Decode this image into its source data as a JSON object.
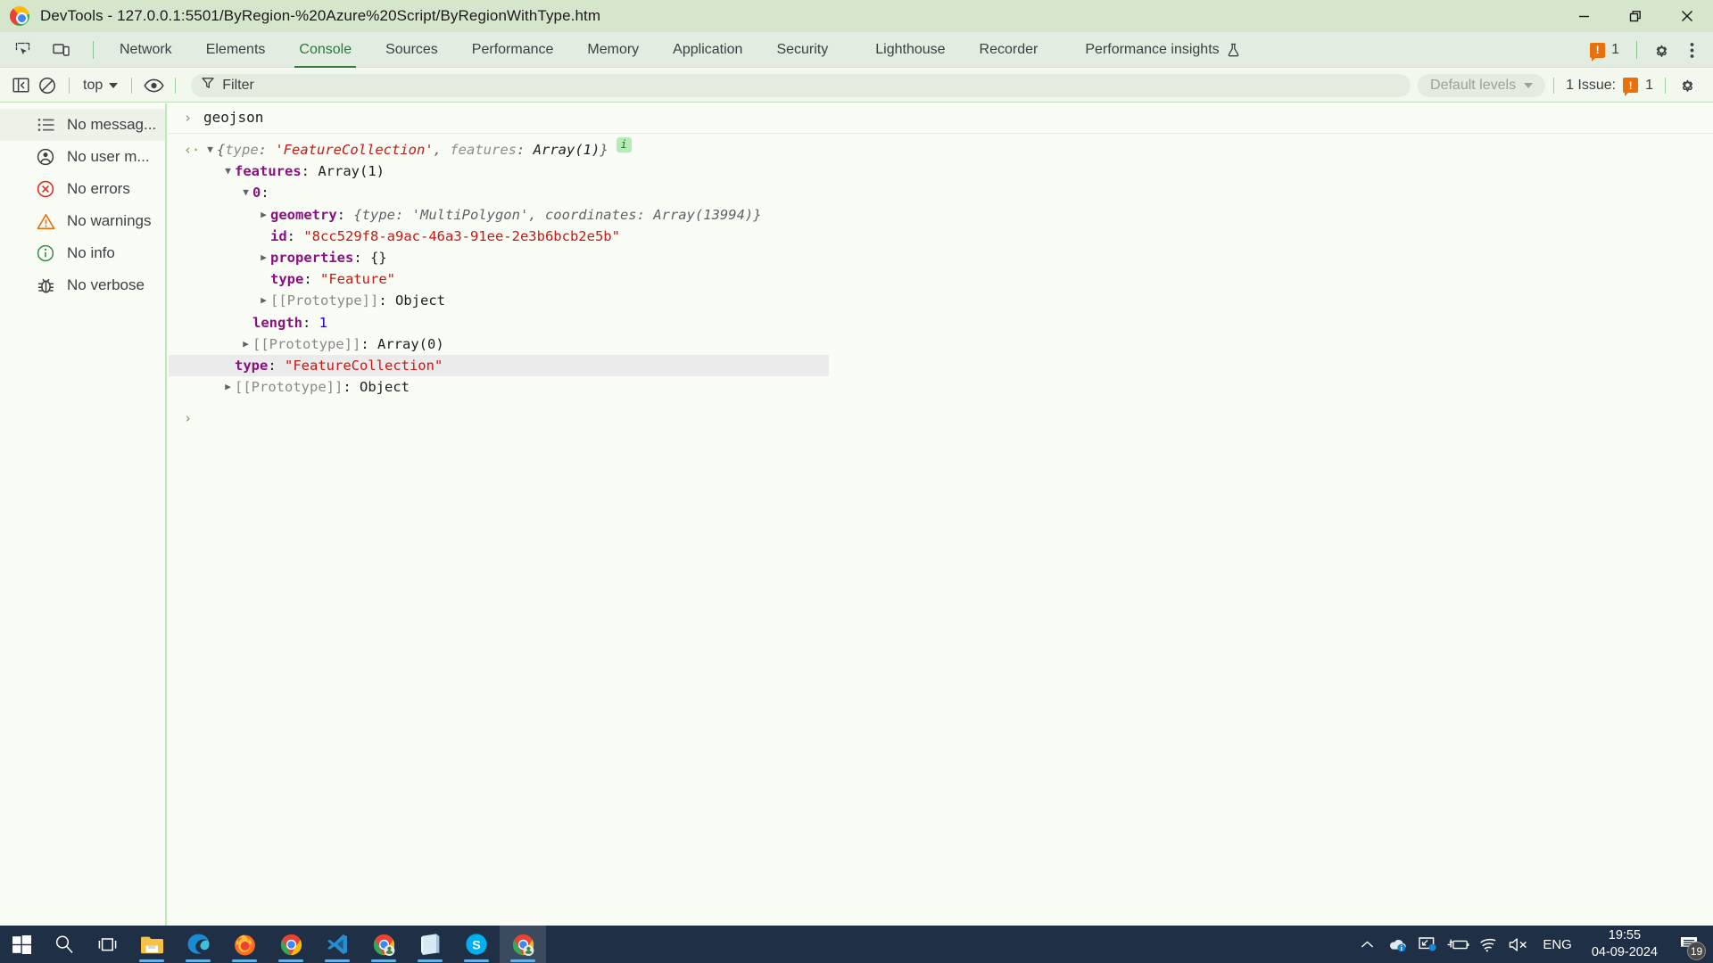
{
  "window": {
    "title": "DevTools - 127.0.0.1:5501/ByRegion-%20Azure%20Script/ByRegionWithType.htm",
    "logo_icon": "chrome-logo-icon",
    "controls": [
      {
        "name": "minimize-button",
        "icon": "minimize-icon"
      },
      {
        "name": "restore-button",
        "icon": "restore-icon"
      },
      {
        "name": "close-button",
        "icon": "close-icon"
      }
    ]
  },
  "tabbar": {
    "left_icons": [
      {
        "name": "inspect-element-icon",
        "label": "Inspect element"
      },
      {
        "name": "device-toolbar-icon",
        "label": "Toggle device toolbar"
      }
    ],
    "tabs": [
      {
        "label": "Network",
        "active": false
      },
      {
        "label": "Elements",
        "active": false
      },
      {
        "label": "Console",
        "active": true
      },
      {
        "label": "Sources",
        "active": false
      },
      {
        "label": "Performance",
        "active": false
      },
      {
        "label": "Memory",
        "active": false
      },
      {
        "label": "Application",
        "active": false
      },
      {
        "label": "Security",
        "active": false
      },
      {
        "label": "Lighthouse",
        "active": false
      },
      {
        "label": "Recorder",
        "active": false
      },
      {
        "label": "Performance insights",
        "active": false,
        "icon": "flask-icon"
      }
    ],
    "issue_count": "1",
    "issue_badge_glyph": "!",
    "settings_icon": "gear-icon",
    "more_icon": "three-dot-menu-icon",
    "accent_color": "#2e7d3c",
    "issue_color": "#e8710a"
  },
  "console_toolbar": {
    "sidebar_toggle_icon": "sidebar-panel-icon",
    "clear_icon": "clear-console-icon",
    "context_selector": "top",
    "eye_icon": "live-expression-eye-icon",
    "filter_placeholder": "Filter",
    "filter_icon": "filter-funnel-icon",
    "levels_label": "Default levels",
    "issue_label": "1 Issue:",
    "issue_count": "1",
    "settings_icon": "gear-icon"
  },
  "sidebar": {
    "items": [
      {
        "label": "No messag...",
        "icon": "list-icon",
        "selected": true
      },
      {
        "label": "No user m...",
        "icon": "user-icon",
        "selected": false
      },
      {
        "label": "No errors",
        "icon": "error-circle-icon",
        "selected": false
      },
      {
        "label": "No warnings",
        "icon": "warning-triangle-icon",
        "selected": false
      },
      {
        "label": "No info",
        "icon": "info-circle-icon",
        "selected": false
      },
      {
        "label": "No verbose",
        "icon": "bug-icon",
        "selected": false
      }
    ]
  },
  "console": {
    "command_gutter": "›",
    "command": "geojson",
    "result_gutter": "‹·",
    "result_header": {
      "triangle": "▼",
      "open": "{",
      "key1": "type",
      "sep": ": ",
      "val1": "'FeatureCollection'",
      "comma": ", ",
      "key2": "features",
      "val2": "Array(1)",
      "close": "}",
      "info_badge": "i"
    },
    "rows": [
      {
        "indent": 1,
        "triangle": "▼",
        "key": "features",
        "key_kind": "prop",
        "value": "Array(1)",
        "value_kind": "plain",
        "highlight": false
      },
      {
        "indent": 2,
        "triangle": "▼",
        "key": "0",
        "key_kind": "prop",
        "value": "",
        "value_kind": "plain",
        "highlight": false
      },
      {
        "indent": 3,
        "triangle": "▶",
        "key": "geometry",
        "key_kind": "prop",
        "value": "{type: 'MultiPolygon', coordinates: Array(13994)}",
        "value_kind": "objpreview",
        "highlight": false
      },
      {
        "indent": 3,
        "triangle": "",
        "key": "id",
        "key_kind": "prop",
        "value": "\"8cc529f8-a9ac-46a3-91ee-2e3b6bcb2e5b\"",
        "value_kind": "string",
        "highlight": false
      },
      {
        "indent": 3,
        "triangle": "▶",
        "key": "properties",
        "key_kind": "prop",
        "value": "{}",
        "value_kind": "plain",
        "highlight": false
      },
      {
        "indent": 3,
        "triangle": "",
        "key": "type",
        "key_kind": "prop",
        "value": "\"Feature\"",
        "value_kind": "string",
        "highlight": false
      },
      {
        "indent": 3,
        "triangle": "▶",
        "key": "[[Prototype]]",
        "key_kind": "proto",
        "value": "Object",
        "value_kind": "plain",
        "highlight": false
      },
      {
        "indent": 2,
        "triangle": "",
        "key": "length",
        "key_kind": "prop",
        "value": "1",
        "value_kind": "number",
        "highlight": false
      },
      {
        "indent": 2,
        "triangle": "▶",
        "key": "[[Prototype]]",
        "key_kind": "proto",
        "value": "Array(0)",
        "value_kind": "plain",
        "highlight": false
      },
      {
        "indent": 1,
        "triangle": "",
        "key": "type",
        "key_kind": "prop",
        "value": "\"FeatureCollection\"",
        "value_kind": "string",
        "highlight": true
      },
      {
        "indent": 1,
        "triangle": "▶",
        "key": "[[Prototype]]",
        "key_kind": "proto",
        "value": "Object",
        "value_kind": "plain",
        "highlight": false
      }
    ],
    "prompt_caret": "›"
  },
  "taskbar": {
    "items": [
      {
        "name": "start-button",
        "icon": "windows-logo-icon",
        "running": false,
        "active": false
      },
      {
        "name": "search-button",
        "icon": "search-icon",
        "running": false,
        "active": false
      },
      {
        "name": "task-view-button",
        "icon": "task-view-icon",
        "running": false,
        "active": false
      },
      {
        "name": "file-explorer-button",
        "icon": "file-explorer-icon",
        "running": true,
        "active": false
      },
      {
        "name": "edge-button",
        "icon": "edge-icon",
        "running": true,
        "active": false
      },
      {
        "name": "firefox-button",
        "icon": "firefox-icon",
        "running": true,
        "active": false
      },
      {
        "name": "chrome-button",
        "icon": "chrome-icon",
        "running": true,
        "active": false
      },
      {
        "name": "vscode-button",
        "icon": "vscode-icon",
        "running": true,
        "active": false
      },
      {
        "name": "chrome-profile-button",
        "icon": "chrome-profile-icon",
        "running": true,
        "active": false
      },
      {
        "name": "notepad-button",
        "icon": "notepad-icon",
        "running": true,
        "active": false
      },
      {
        "name": "skype-button",
        "icon": "skype-icon",
        "running": true,
        "active": false
      },
      {
        "name": "chrome-devtools-button",
        "icon": "chrome-profile-icon",
        "running": true,
        "active": true
      }
    ],
    "tray": {
      "chevron_icon": "chevron-up-icon",
      "onedrive_icon": "onedrive-icon",
      "screen-share_icon": "screen-share-icon",
      "battery_icon": "battery-charging-icon",
      "wifi_icon": "wifi-icon",
      "volume_icon": "volume-muted-icon",
      "language": "ENG",
      "time": "19:55",
      "date": "04-09-2024",
      "notification_icon": "notification-icon",
      "notification_count": "19"
    }
  }
}
